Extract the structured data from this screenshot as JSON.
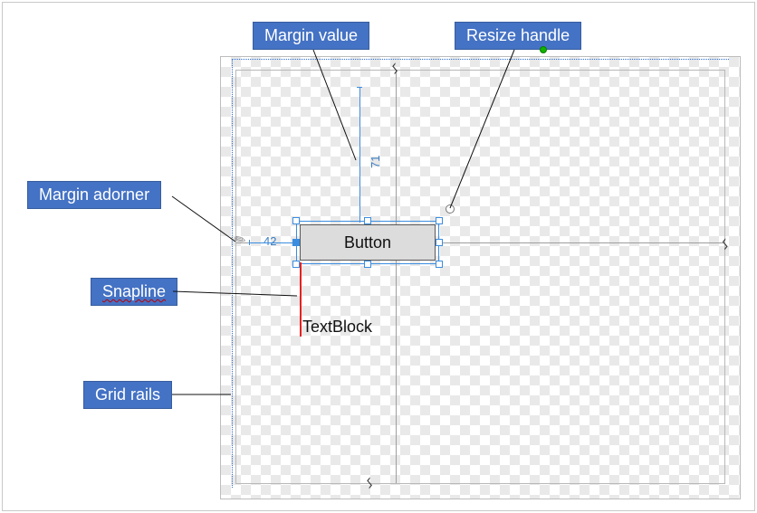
{
  "callouts": {
    "margin_value": "Margin value",
    "resize_handle": "Resize handle",
    "margin_adorner": "Margin adorner",
    "snapline": "Snapline",
    "grid_rails": "Grid rails"
  },
  "designer": {
    "button_label": "Button",
    "textblock_label": "TextBlock",
    "margin_top_value": "71",
    "margin_left_value": "42",
    "row_split_symbol": "ᛊ",
    "adorner_glyph": "✎"
  },
  "colors": {
    "callout_bg": "#4472c4",
    "callout_border": "#385d9e",
    "selection": "#3b8de0",
    "snapline": "#e62121",
    "green_dot": "#12b300"
  }
}
